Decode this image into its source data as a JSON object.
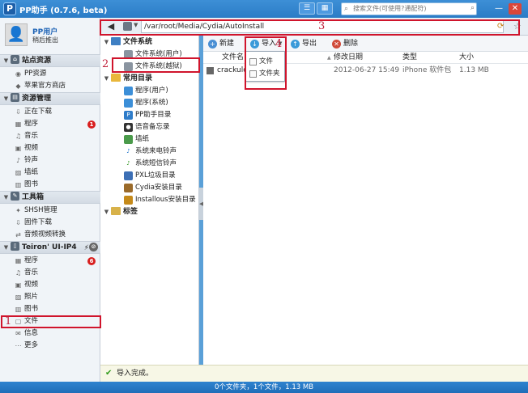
{
  "window": {
    "title": "PP助手 (0.7.6, beta)",
    "search_placeholder": "搜索文件(可使用?通配符)",
    "minimize": "—",
    "close": "✕"
  },
  "user": {
    "name": "PP用户",
    "login": "稍后推出"
  },
  "sidebar": {
    "sections": [
      {
        "label": "站点资源"
      },
      {
        "label": "资源管理"
      },
      {
        "label": "工具箱"
      },
      {
        "label": "Teiron' UI-IP4",
        "ext_badge": "⚡",
        "ext_badge2": "⊘"
      }
    ],
    "site_items": [
      {
        "label": "PP资源"
      },
      {
        "label": "苹果官方商店"
      }
    ],
    "resource_items": [
      {
        "label": "正在下载"
      },
      {
        "label": "程序",
        "badge": "1"
      },
      {
        "label": "音乐"
      },
      {
        "label": "视频"
      },
      {
        "label": "铃声"
      },
      {
        "label": "墙纸"
      },
      {
        "label": "图书"
      }
    ],
    "tool_items": [
      {
        "label": "SHSH管理"
      },
      {
        "label": "固件下载"
      },
      {
        "label": "音频视频转换"
      }
    ],
    "device_items": [
      {
        "label": "程序",
        "badge": "6"
      },
      {
        "label": "音乐"
      },
      {
        "label": "视频"
      },
      {
        "label": "照片"
      },
      {
        "label": "图书"
      },
      {
        "label": "文件"
      },
      {
        "label": "信息"
      },
      {
        "label": "更多"
      }
    ]
  },
  "path": {
    "value": "/var/root/Media/Cydia/AutoInstall"
  },
  "tree": {
    "filesystem": "文件系统",
    "fs_items": [
      "文件系统(用户)",
      "文件系统(越狱)"
    ],
    "common": "常用目录",
    "common_items": [
      "程序(用户)",
      "程序(系统)",
      "PP助手目录",
      "语音备忘录",
      "墙纸",
      "系统来电铃声",
      "系统短信铃声",
      "PXL垃圾目录",
      "Cydia安装目录",
      "Installous安装目录"
    ],
    "tags": "标签"
  },
  "toolbar": {
    "new": "新建",
    "import": "导入",
    "export": "导出",
    "delete": "删除"
  },
  "import_menu": [
    "文件",
    "文件夹"
  ],
  "table": {
    "headers": [
      "文件名",
      "修改日期",
      "类型",
      "大小"
    ],
    "rows": [
      {
        "name": "crackulous",
        "date": "2012-06-27 15:49",
        "type": "iPhone 软件包",
        "size": "1.13 MB"
      }
    ]
  },
  "annotations": [
    "1",
    "2",
    "3",
    "4"
  ],
  "status": {
    "message": "导入完成。",
    "summary": "0个文件夹，1个文件，1.13 MB"
  },
  "colors": {
    "highlight": "#d0142c",
    "titlebar": "#2b7cc6",
    "badge": "#d81e1e"
  }
}
